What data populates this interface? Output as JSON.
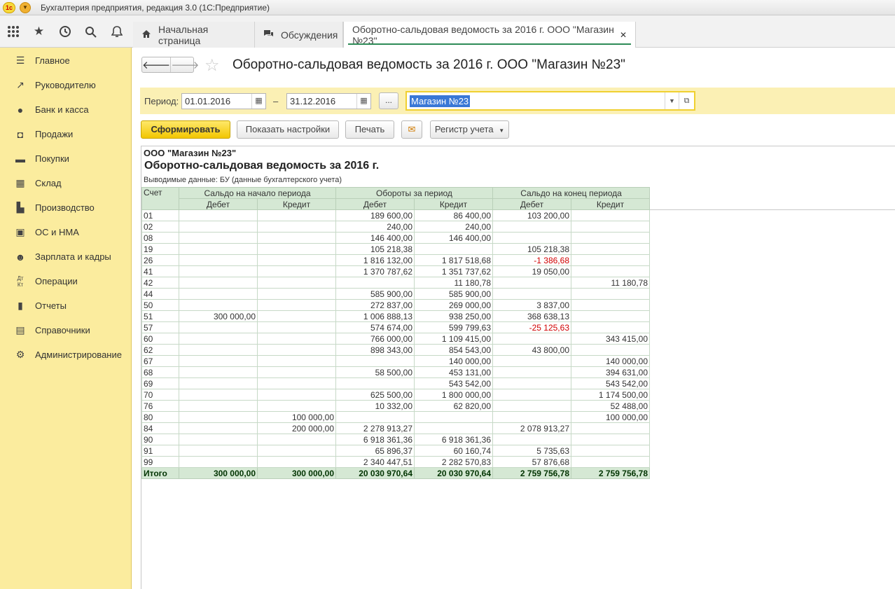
{
  "window": {
    "title": "Бухгалтерия предприятия, редакция 3.0 (1С:Предприятие)",
    "logo_text": "1с"
  },
  "topbar": {
    "icons": [
      "apps-grid-icon",
      "favorites-star-icon",
      "history-icon",
      "search-icon",
      "notifications-bell-icon"
    ],
    "tabs": [
      {
        "label": "Начальная страница",
        "icon": "home-icon"
      },
      {
        "label": "Обсуждения",
        "icon": "discussions-icon"
      },
      {
        "label": "Оборотно-сальдовая ведомость за 2016 г. ООО \"Магазин №23\"",
        "active": true
      }
    ]
  },
  "sidebar": {
    "items": [
      {
        "label": "Главное",
        "icon": "menu-lines-icon"
      },
      {
        "label": "Руководителю",
        "icon": "trend-chart-icon"
      },
      {
        "label": "Банк и касса",
        "icon": "coin-icon"
      },
      {
        "label": "Продажи",
        "icon": "sales-bag-icon"
      },
      {
        "label": "Покупки",
        "icon": "cart-icon"
      },
      {
        "label": "Склад",
        "icon": "warehouse-grid-icon"
      },
      {
        "label": "Производство",
        "icon": "factory-icon"
      },
      {
        "label": "ОС и НМА",
        "icon": "truck-icon"
      },
      {
        "label": "Зарплата и кадры",
        "icon": "person-icon"
      },
      {
        "label": "Операции",
        "icon": "dt-kt-icon"
      },
      {
        "label": "Отчеты",
        "icon": "bar-chart-icon"
      },
      {
        "label": "Справочники",
        "icon": "book-icon"
      },
      {
        "label": "Администрирование",
        "icon": "gear-icon"
      }
    ]
  },
  "header": {
    "title": "Оборотно-сальдовая ведомость за 2016 г. ООО \"Магазин №23\""
  },
  "period": {
    "label": "Период:",
    "from": "01.01.2016",
    "dash": "–",
    "to": "31.12.2016",
    "dots": "...",
    "organization": "Магазин №23"
  },
  "toolbar": {
    "generate": "Сформировать",
    "show_settings": "Показать настройки",
    "print": "Печать",
    "register": "Регистр учета"
  },
  "report": {
    "org": "ООО \"Магазин №23\"",
    "title": "Оборотно-сальдовая ведомость за 2016 г.",
    "subtitle": "Выводимые данные:  БУ (данные бухгалтерского учета)",
    "headers": {
      "account": "Счет",
      "opening": "Сальдо на начало периода",
      "turnover": "Обороты за период",
      "closing": "Сальдо на конец периода",
      "debit": "Дебет",
      "credit": "Кредит"
    },
    "rows": [
      [
        "01",
        "",
        "",
        "189 600,00",
        "86 400,00",
        "103 200,00",
        ""
      ],
      [
        "02",
        "",
        "",
        "240,00",
        "240,00",
        "",
        ""
      ],
      [
        "08",
        "",
        "",
        "146 400,00",
        "146 400,00",
        "",
        ""
      ],
      [
        "19",
        "",
        "",
        "105 218,38",
        "",
        "105 218,38",
        ""
      ],
      [
        "26",
        "",
        "",
        "1 816 132,00",
        "1 817 518,68",
        "-1 386,68",
        ""
      ],
      [
        "41",
        "",
        "",
        "1 370 787,62",
        "1 351 737,62",
        "19 050,00",
        ""
      ],
      [
        "42",
        "",
        "",
        "",
        "11 180,78",
        "",
        "11 180,78"
      ],
      [
        "44",
        "",
        "",
        "585 900,00",
        "585 900,00",
        "",
        ""
      ],
      [
        "50",
        "",
        "",
        "272 837,00",
        "269 000,00",
        "3 837,00",
        ""
      ],
      [
        "51",
        "300 000,00",
        "",
        "1 006 888,13",
        "938 250,00",
        "368 638,13",
        ""
      ],
      [
        "57",
        "",
        "",
        "574 674,00",
        "599 799,63",
        "-25 125,63",
        ""
      ],
      [
        "60",
        "",
        "",
        "766 000,00",
        "1 109 415,00",
        "",
        "343 415,00"
      ],
      [
        "62",
        "",
        "",
        "898 343,00",
        "854 543,00",
        "43 800,00",
        ""
      ],
      [
        "67",
        "",
        "",
        "",
        "140 000,00",
        "",
        "140 000,00"
      ],
      [
        "68",
        "",
        "",
        "58 500,00",
        "453 131,00",
        "",
        "394 631,00"
      ],
      [
        "69",
        "",
        "",
        "",
        "543 542,00",
        "",
        "543 542,00"
      ],
      [
        "70",
        "",
        "",
        "625 500,00",
        "1 800 000,00",
        "",
        "1 174 500,00"
      ],
      [
        "76",
        "",
        "",
        "10 332,00",
        "62 820,00",
        "",
        "52 488,00"
      ],
      [
        "80",
        "",
        "100 000,00",
        "",
        "",
        "",
        "100 000,00"
      ],
      [
        "84",
        "",
        "200 000,00",
        "2 278 913,27",
        "",
        "2 078 913,27",
        ""
      ],
      [
        "90",
        "",
        "",
        "6 918 361,36",
        "6 918 361,36",
        "",
        ""
      ],
      [
        "91",
        "",
        "",
        "65 896,37",
        "60 160,74",
        "5 735,63",
        ""
      ],
      [
        "99",
        "",
        "",
        "2 340 447,51",
        "2 282 570,83",
        "57 876,68",
        ""
      ]
    ],
    "total": [
      "Итого",
      "300 000,00",
      "300 000,00",
      "20 030 970,64",
      "20 030 970,64",
      "2 759 756,78",
      "2 759 756,78"
    ]
  },
  "colors": {
    "sidebar_bg": "#fbec9e",
    "primary_btn": "#f2c600",
    "table_header": "#d5e8d4",
    "negative": "#d00000",
    "selection": "#3a78d6"
  }
}
